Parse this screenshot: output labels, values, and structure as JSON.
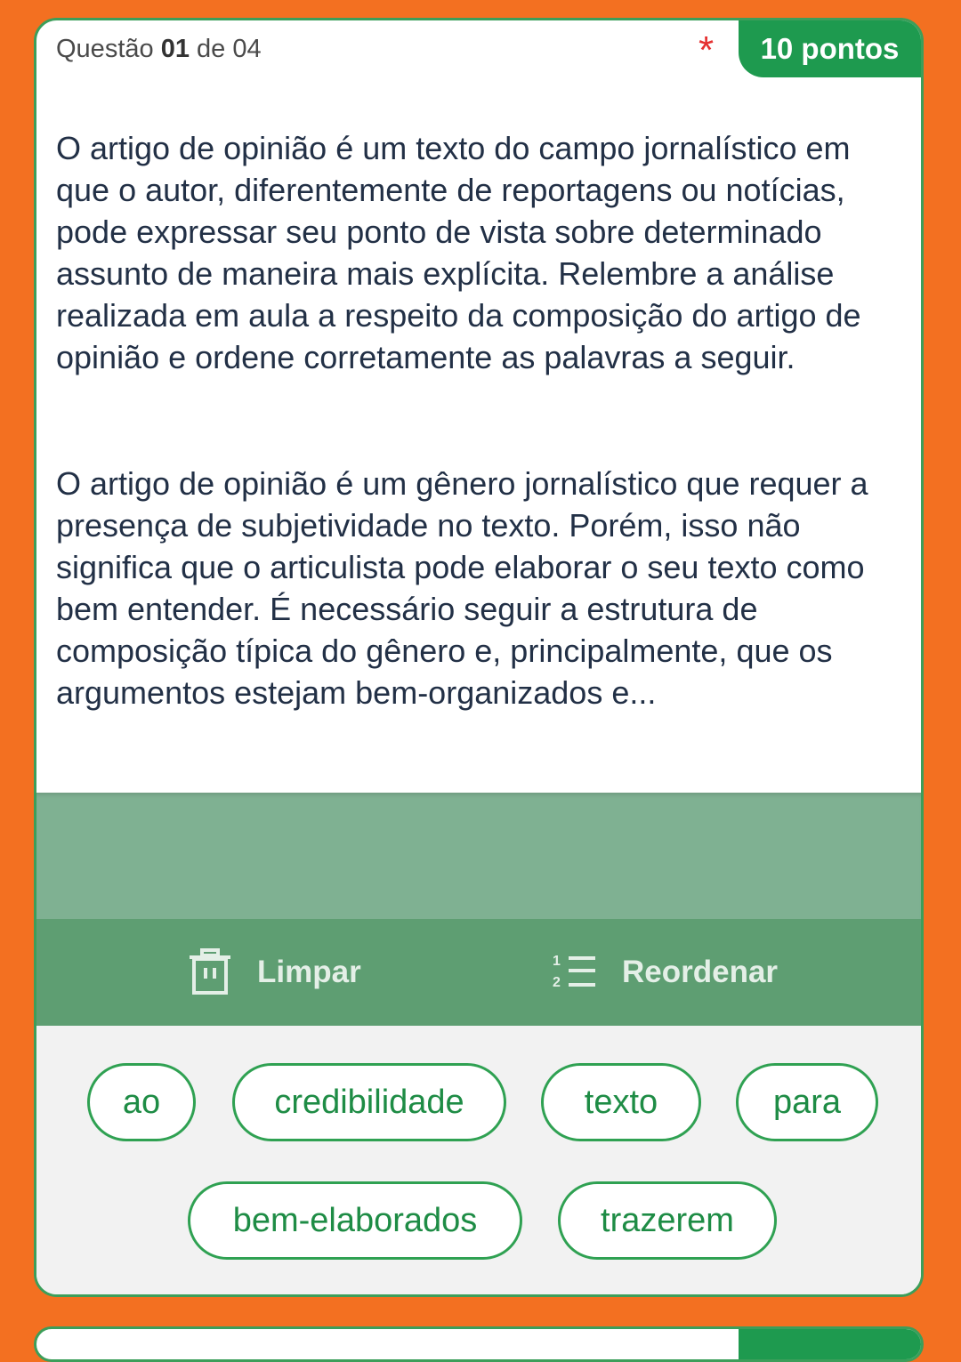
{
  "question": {
    "label_prefix": "Questão",
    "number": "01",
    "label_of": "de",
    "total": "04",
    "required_marker": "*",
    "points": "10 pontos"
  },
  "statement": {
    "paragraph1": "O artigo de opinião é um texto do campo jornalístico em que o autor, diferentemente de reportagens ou notícias, pode expressar seu ponto de vista sobre determinado assunto de maneira mais explícita. Relembre a análise realizada em aula a respeito da composição do artigo de opinião e ordene corretamente as palavras a seguir.",
    "paragraph2": "O artigo de opinião é um gênero jornalístico que requer a presença de subjetividade no texto. Porém, isso não significa que o articulista pode elaborar o seu texto como bem entender. É necessário seguir a estrutura de composição típica do gênero e, principalmente, que os argumentos estejam bem-organizados e..."
  },
  "toolbar": {
    "clear_label": "Limpar",
    "clear_icon": "trash-icon",
    "reorder_label": "Reordenar",
    "reorder_icon": "ordered-list-icon"
  },
  "words": [
    "ao",
    "credibilidade",
    "texto",
    "para",
    "bem-elaborados",
    "trazerem"
  ],
  "colors": {
    "background": "#F37021",
    "accent": "#1E9A4F",
    "chip_border": "#2FA152",
    "dropzone": "#7FB192",
    "toolbar": "#5E9E72"
  }
}
